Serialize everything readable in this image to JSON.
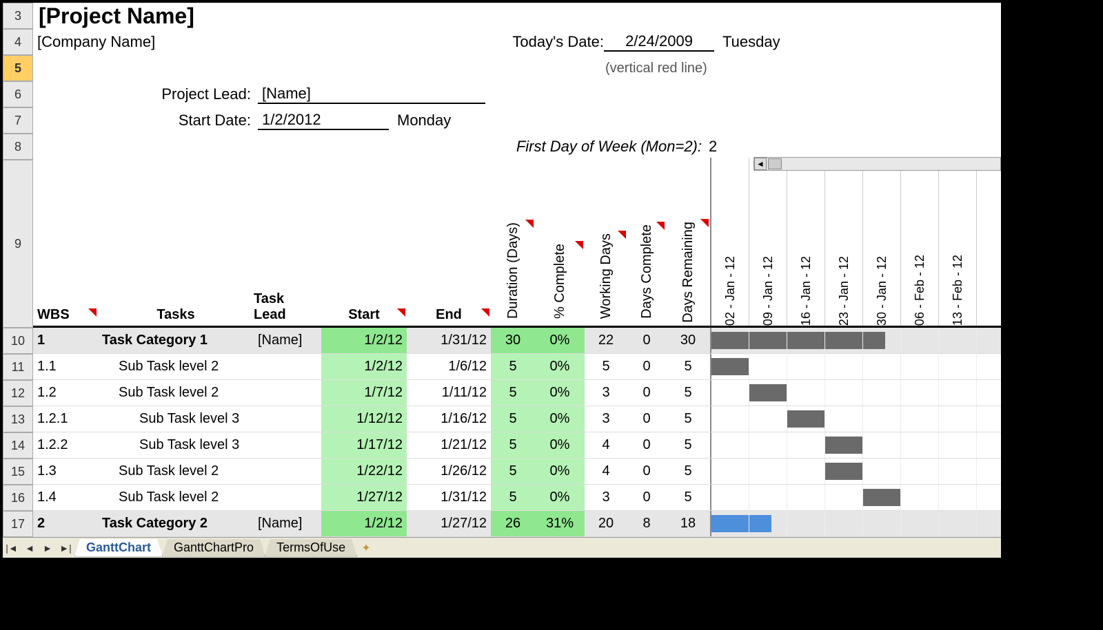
{
  "row_headers": [
    "3",
    "4",
    "5",
    "6",
    "7",
    "8",
    "9",
    "10",
    "11",
    "12",
    "13",
    "14",
    "15",
    "16",
    "17"
  ],
  "selected_row": "5",
  "title": "[Project Name]",
  "company": "[Company Name]",
  "today_label": "Today's Date:",
  "today_value": "2/24/2009",
  "today_day": "Tuesday",
  "vertical_note": "(vertical red line)",
  "lead_label": "Project Lead:",
  "lead_value": "[Name]",
  "startdate_label": "Start Date:",
  "startdate_value": "1/2/2012",
  "startdate_day": "Monday",
  "fdow_label": "First Day of Week (Mon=2):",
  "fdow_value": "2",
  "columns": {
    "wbs": "WBS",
    "tasks": "Tasks",
    "lead": "Task Lead",
    "start": "Start",
    "end": "End",
    "dur": "Duration (Days)",
    "pct": "% Complete",
    "wd": "Working Days",
    "dc": "Days Complete",
    "dr": "Days Remaining"
  },
  "gantt_weeks": [
    "02 - Jan - 12",
    "09 - Jan - 12",
    "16 - Jan - 12",
    "23 - Jan - 12",
    "30 - Jan - 12",
    "06 - Feb - 12",
    "13 - Feb - 12"
  ],
  "rows": [
    {
      "wbs": "1",
      "task": "Task Category 1",
      "indent": 0,
      "lead": "[Name]",
      "start": "1/2/12",
      "end": "1/31/12",
      "dur": "30",
      "pct": "0%",
      "wd": "22",
      "dc": "0",
      "dr": "30",
      "cat": true,
      "bars": [
        1,
        1,
        1,
        1,
        0.6,
        0,
        0
      ],
      "barcolor": "gray"
    },
    {
      "wbs": "1.1",
      "task": "Sub Task level 2",
      "indent": 1,
      "lead": "",
      "start": "1/2/12",
      "end": "1/6/12",
      "dur": "5",
      "pct": "0%",
      "wd": "5",
      "dc": "0",
      "dr": "5",
      "cat": false,
      "bars": [
        1,
        0,
        0,
        0,
        0,
        0,
        0
      ],
      "barcolor": "gray"
    },
    {
      "wbs": "1.2",
      "task": "Sub Task level 2",
      "indent": 1,
      "lead": "",
      "start": "1/7/12",
      "end": "1/11/12",
      "dur": "5",
      "pct": "0%",
      "wd": "3",
      "dc": "0",
      "dr": "5",
      "cat": false,
      "bars": [
        0,
        1,
        0,
        0,
        0,
        0,
        0
      ],
      "barcolor": "gray"
    },
    {
      "wbs": "1.2.1",
      "task": "Sub Task level 3",
      "indent": 2,
      "lead": "",
      "start": "1/12/12",
      "end": "1/16/12",
      "dur": "5",
      "pct": "0%",
      "wd": "3",
      "dc": "0",
      "dr": "5",
      "cat": false,
      "bars": [
        0,
        0,
        1,
        0,
        0,
        0,
        0
      ],
      "barcolor": "gray"
    },
    {
      "wbs": "1.2.2",
      "task": "Sub Task level 3",
      "indent": 2,
      "lead": "",
      "start": "1/17/12",
      "end": "1/21/12",
      "dur": "5",
      "pct": "0%",
      "wd": "4",
      "dc": "0",
      "dr": "5",
      "cat": false,
      "bars": [
        0,
        0,
        0,
        1,
        0,
        0,
        0
      ],
      "barcolor": "gray"
    },
    {
      "wbs": "1.3",
      "task": "Sub Task level 2",
      "indent": 1,
      "lead": "",
      "start": "1/22/12",
      "end": "1/26/12",
      "dur": "5",
      "pct": "0%",
      "wd": "4",
      "dc": "0",
      "dr": "5",
      "cat": false,
      "bars": [
        0,
        0,
        0,
        1,
        0,
        0,
        0
      ],
      "barcolor": "gray"
    },
    {
      "wbs": "1.4",
      "task": "Sub Task level 2",
      "indent": 1,
      "lead": "",
      "start": "1/27/12",
      "end": "1/31/12",
      "dur": "5",
      "pct": "0%",
      "wd": "3",
      "dc": "0",
      "dr": "5",
      "cat": false,
      "bars": [
        0,
        0,
        0,
        0,
        1,
        0,
        0
      ],
      "barcolor": "gray"
    },
    {
      "wbs": "2",
      "task": "Task Category 2",
      "indent": 0,
      "lead": "[Name]",
      "start": "1/2/12",
      "end": "1/27/12",
      "dur": "26",
      "pct": "31%",
      "wd": "20",
      "dc": "8",
      "dr": "18",
      "cat": true,
      "bars": [
        1,
        0.6,
        0,
        0,
        0,
        0,
        0
      ],
      "barcolor": "blue"
    }
  ],
  "sheet_tabs": [
    "GanttChart",
    "GanttChartPro",
    "TermsOfUse"
  ],
  "active_tab": 0
}
